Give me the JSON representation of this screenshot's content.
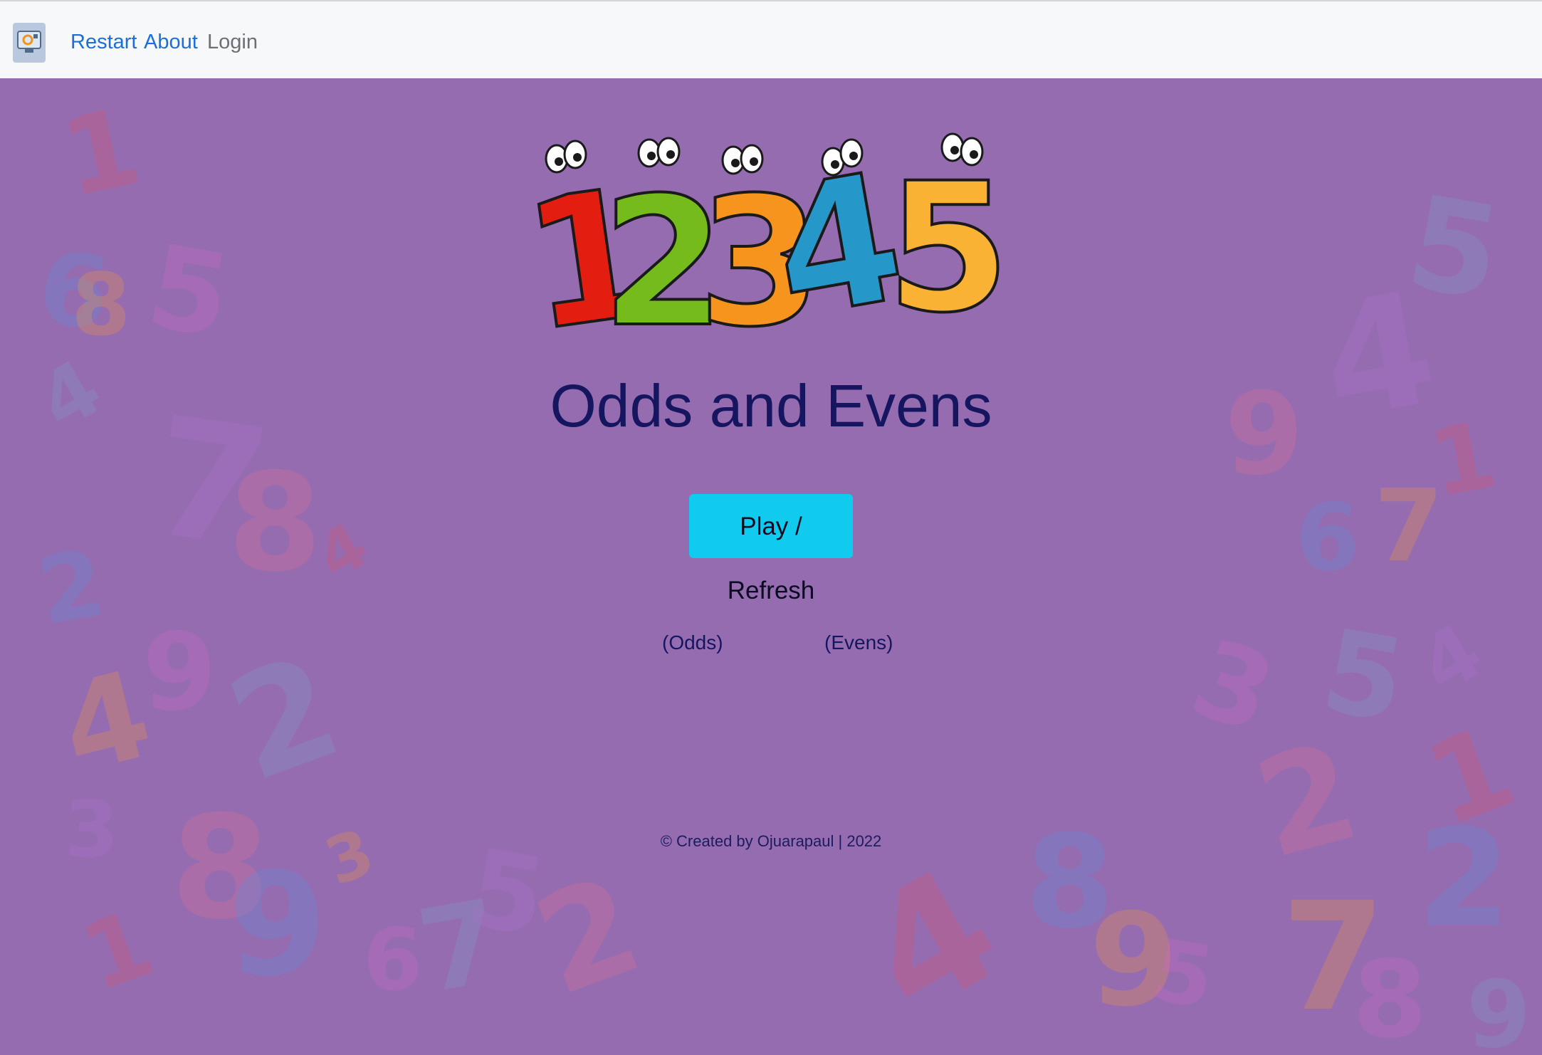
{
  "navbar": {
    "brand_icon": "monitor-logo-icon",
    "links": [
      {
        "label": "Restart"
      },
      {
        "label": "About"
      },
      {
        "label": "Login"
      }
    ]
  },
  "main": {
    "logo_digits": [
      "1",
      "2",
      "3",
      "4",
      "5"
    ],
    "title": "Odds and Evens",
    "play_button": "Play / Refresh",
    "odds_label": "(Odds)",
    "evens_label": "(Evens)",
    "footer": "© Created by Ojuarapaul | 2022"
  },
  "colors": {
    "background": "#956cb0",
    "navbar": "#f7f8fa",
    "link": "#1c6fd8",
    "button": "#11cbef",
    "title": "#161660",
    "digit_red": "#e31e10",
    "digit_green": "#75bb1b",
    "digit_orange": "#f7941d",
    "digit_blue": "#2697c9",
    "digit_yellow": "#f9b233"
  }
}
